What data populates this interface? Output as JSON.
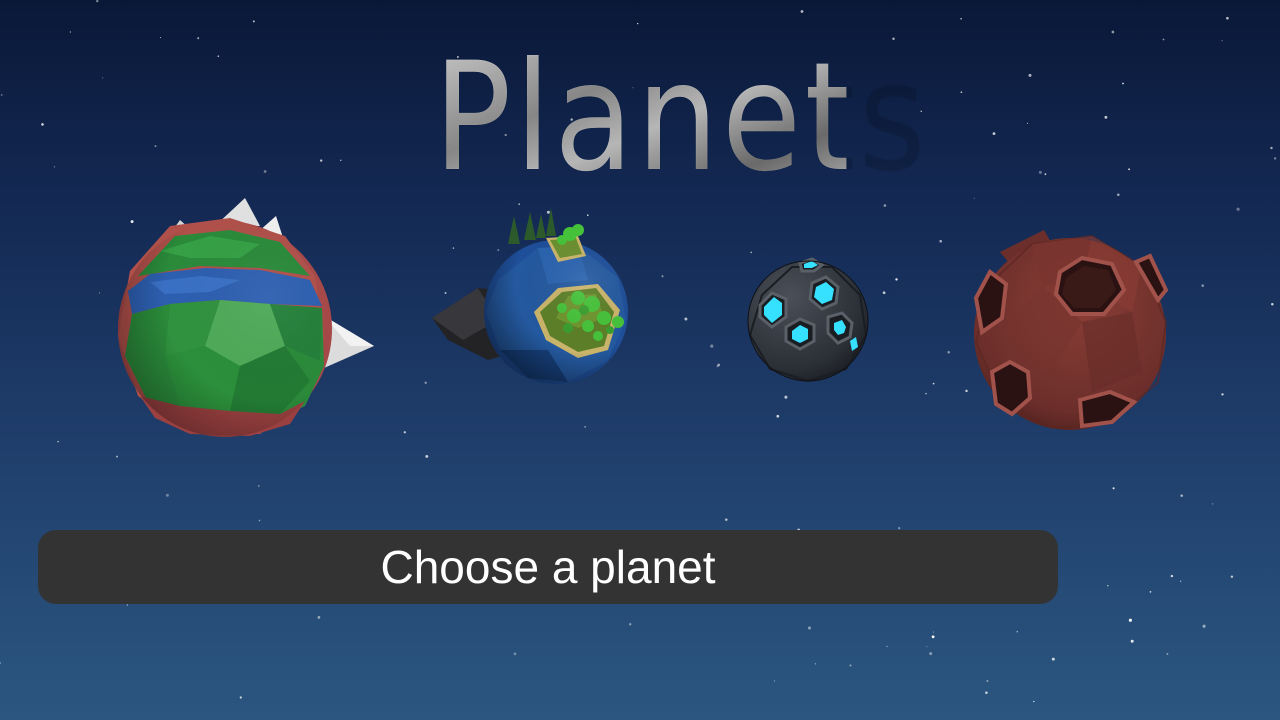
{
  "title": "Planets",
  "prompt": {
    "label": "Choose a planet"
  },
  "planets": [
    {
      "name": "green-red-planet",
      "colors": [
        "#2a8a3a",
        "#2d5fb0",
        "#b04a4a",
        "#e6e6e6"
      ]
    },
    {
      "name": "island-planet",
      "colors": [
        "#1f4f9a",
        "#6b8f2f",
        "#46c23a",
        "#2a2a2a"
      ]
    },
    {
      "name": "crystal-planet",
      "colors": [
        "#2b2f36",
        "#36e0ff"
      ]
    },
    {
      "name": "red-crater-planet",
      "colors": [
        "#6b2e2a",
        "#8a3d36",
        "#2a1212"
      ]
    }
  ],
  "colors": {
    "sky_top": "#0a1838",
    "sky_bottom": "#2b5680",
    "bar_bg": "#333333",
    "bar_text": "#ffffff"
  }
}
